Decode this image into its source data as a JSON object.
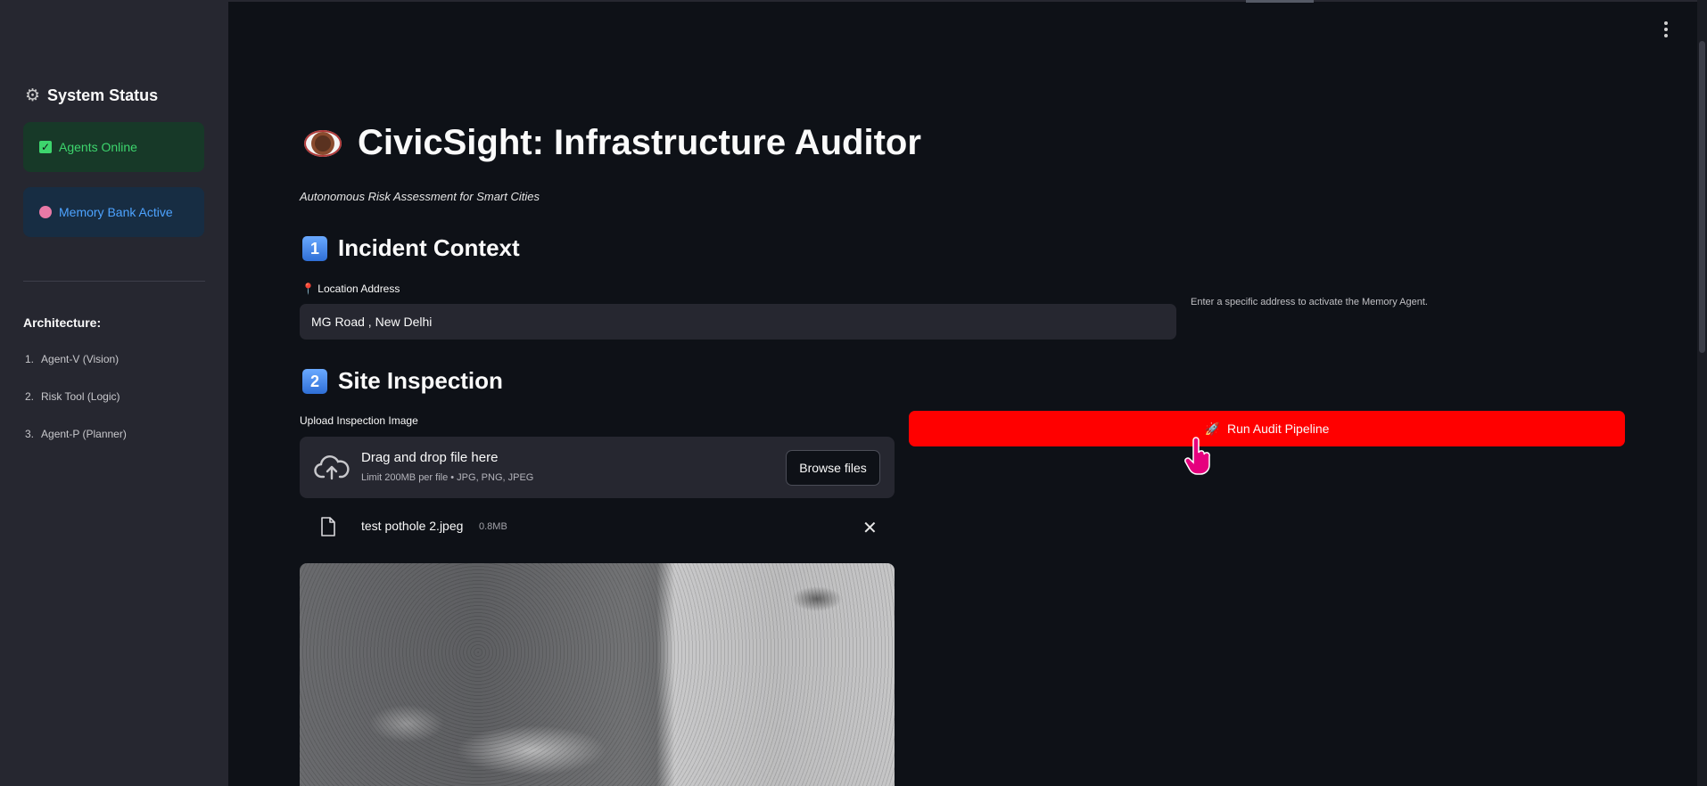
{
  "sidebar": {
    "title": "System Status",
    "status_agents": "Agents Online",
    "status_memory": "Memory Bank Active",
    "architecture_title": "Architecture:",
    "architecture_items": [
      {
        "num": "1.",
        "label": "Agent-V (Vision)"
      },
      {
        "num": "2.",
        "label": "Risk Tool (Logic)"
      },
      {
        "num": "3.",
        "label": "Agent-P (Planner)"
      }
    ]
  },
  "main": {
    "title": "CivicSight: Infrastructure Auditor",
    "subtitle": "Autonomous Risk Assessment for Smart Cities",
    "section1": {
      "num": "1",
      "title": "Incident Context"
    },
    "location_label": "Location Address",
    "location_value": "MG Road , New Delhi",
    "location_hint": "Enter a specific address to activate the Memory Agent.",
    "section2": {
      "num": "2",
      "title": "Site Inspection"
    },
    "upload_label": "Upload Inspection Image",
    "drop_text": "Drag and drop file here",
    "limit_text": "Limit 200MB per file • JPG, PNG, JPEG",
    "browse_label": "Browse files",
    "file_name": "test pothole 2.jpeg",
    "file_size": "0.8MB",
    "run_label": "Run Audit Pipeline"
  },
  "colors": {
    "background": "#0e1117",
    "sidebar": "#262730",
    "primary_button": "#ff0000",
    "success": "#3dd56d",
    "info": "#4da3ff"
  },
  "icons": [
    "gear-icon",
    "check-icon",
    "brain-icon",
    "eye-icon",
    "pin-icon",
    "upload-cloud-icon",
    "file-icon",
    "close-icon",
    "rocket-icon",
    "kebab-menu-icon"
  ]
}
